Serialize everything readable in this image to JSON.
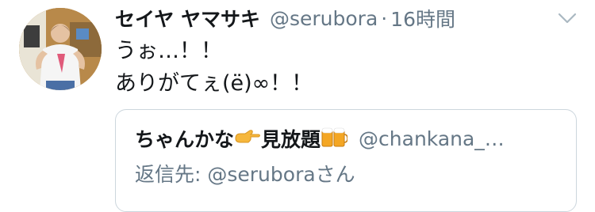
{
  "tweet": {
    "display_name": "セイヤ ヤマサキ",
    "handle": "@serubora",
    "separator": "·",
    "time": "16時間",
    "lines": [
      "うぉ…！！",
      "ありがてぇ(ë)∞！！"
    ]
  },
  "quote": {
    "name_text": "ちゃんかな",
    "name_suffix": "見放題",
    "handle": "@chankana_…",
    "reply_prefix": "返信先: ",
    "reply_user": "@seruboraさん",
    "emojis": [
      "pointing-hand-icon",
      "beer-mugs-icon"
    ]
  },
  "icons": {
    "menu": "chevron-down-icon"
  },
  "colors": {
    "primary_text": "#14171a",
    "secondary_text": "#657786",
    "border": "#ccd6dd",
    "background": "#ffffff"
  }
}
